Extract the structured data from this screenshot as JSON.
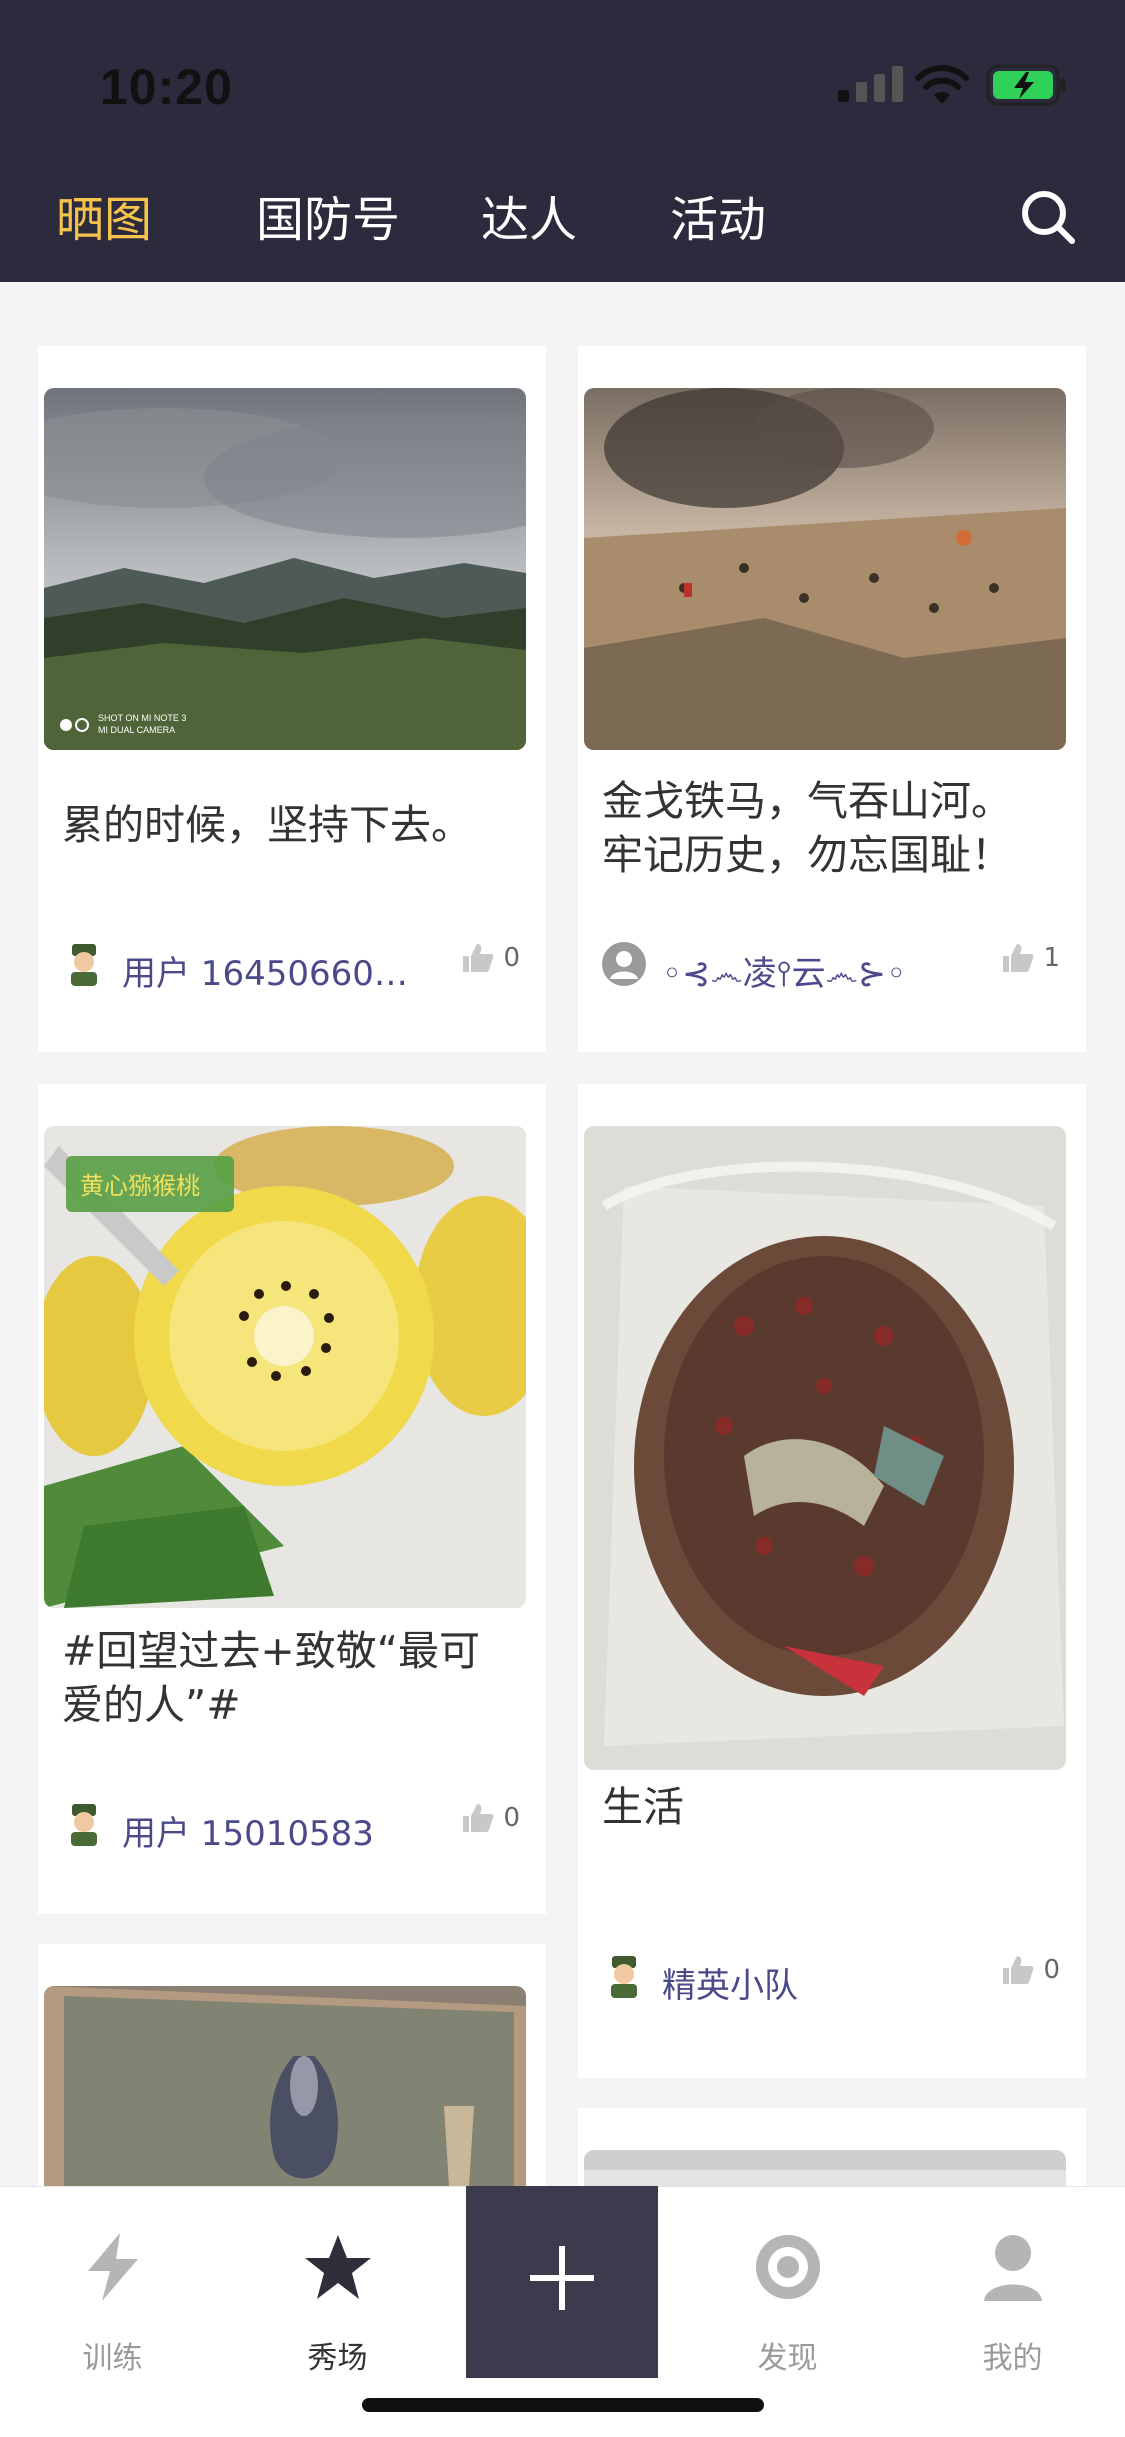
{
  "status_bar": {
    "time": "10:20"
  },
  "tabs": [
    {
      "label": "晒图",
      "active": true
    },
    {
      "label": "国防号",
      "active": false
    },
    {
      "label": "达人",
      "active": false
    },
    {
      "label": "活动",
      "active": false
    }
  ],
  "cards": [
    {
      "title": "累的时候，坚持下去。",
      "author": "用户 164506607...",
      "likes": "0",
      "image": "mountain-landscape",
      "image_caption": "SHOT ON MI NOTE 3\nMI DUAL CAMERA"
    },
    {
      "title": "金戈铁马，气吞山河。\n牢记历史，勿忘国耻！",
      "author": "◦⊰෴凌⫯云෴⊱◦",
      "likes": "1",
      "image": "battle-diorama"
    },
    {
      "title": "#回望过去+致敬“最可\n爱的人”#",
      "author": "用户 15010583",
      "likes": "0",
      "image": "kiwi-fruit",
      "image_tag": "黄心猕猴桃"
    },
    {
      "title": "生活",
      "author": "精英小队",
      "likes": "0",
      "image": "plastic-bag-food"
    },
    {
      "image": "still-life-painting"
    },
    {
      "image": "room-photo"
    }
  ],
  "bottom_nav": [
    {
      "label": "训练",
      "icon": "lightning-icon",
      "active": false
    },
    {
      "label": "秀场",
      "icon": "star-icon",
      "active": true
    },
    {
      "label": "",
      "icon": "plus-icon",
      "active": false
    },
    {
      "label": "发现",
      "icon": "eye-icon",
      "active": false
    },
    {
      "label": "我的",
      "icon": "user-icon",
      "active": false
    }
  ],
  "colors": {
    "header_bg": "#2b2b3d",
    "active_tab": "#f6c34c",
    "author": "#4a4a8a"
  }
}
